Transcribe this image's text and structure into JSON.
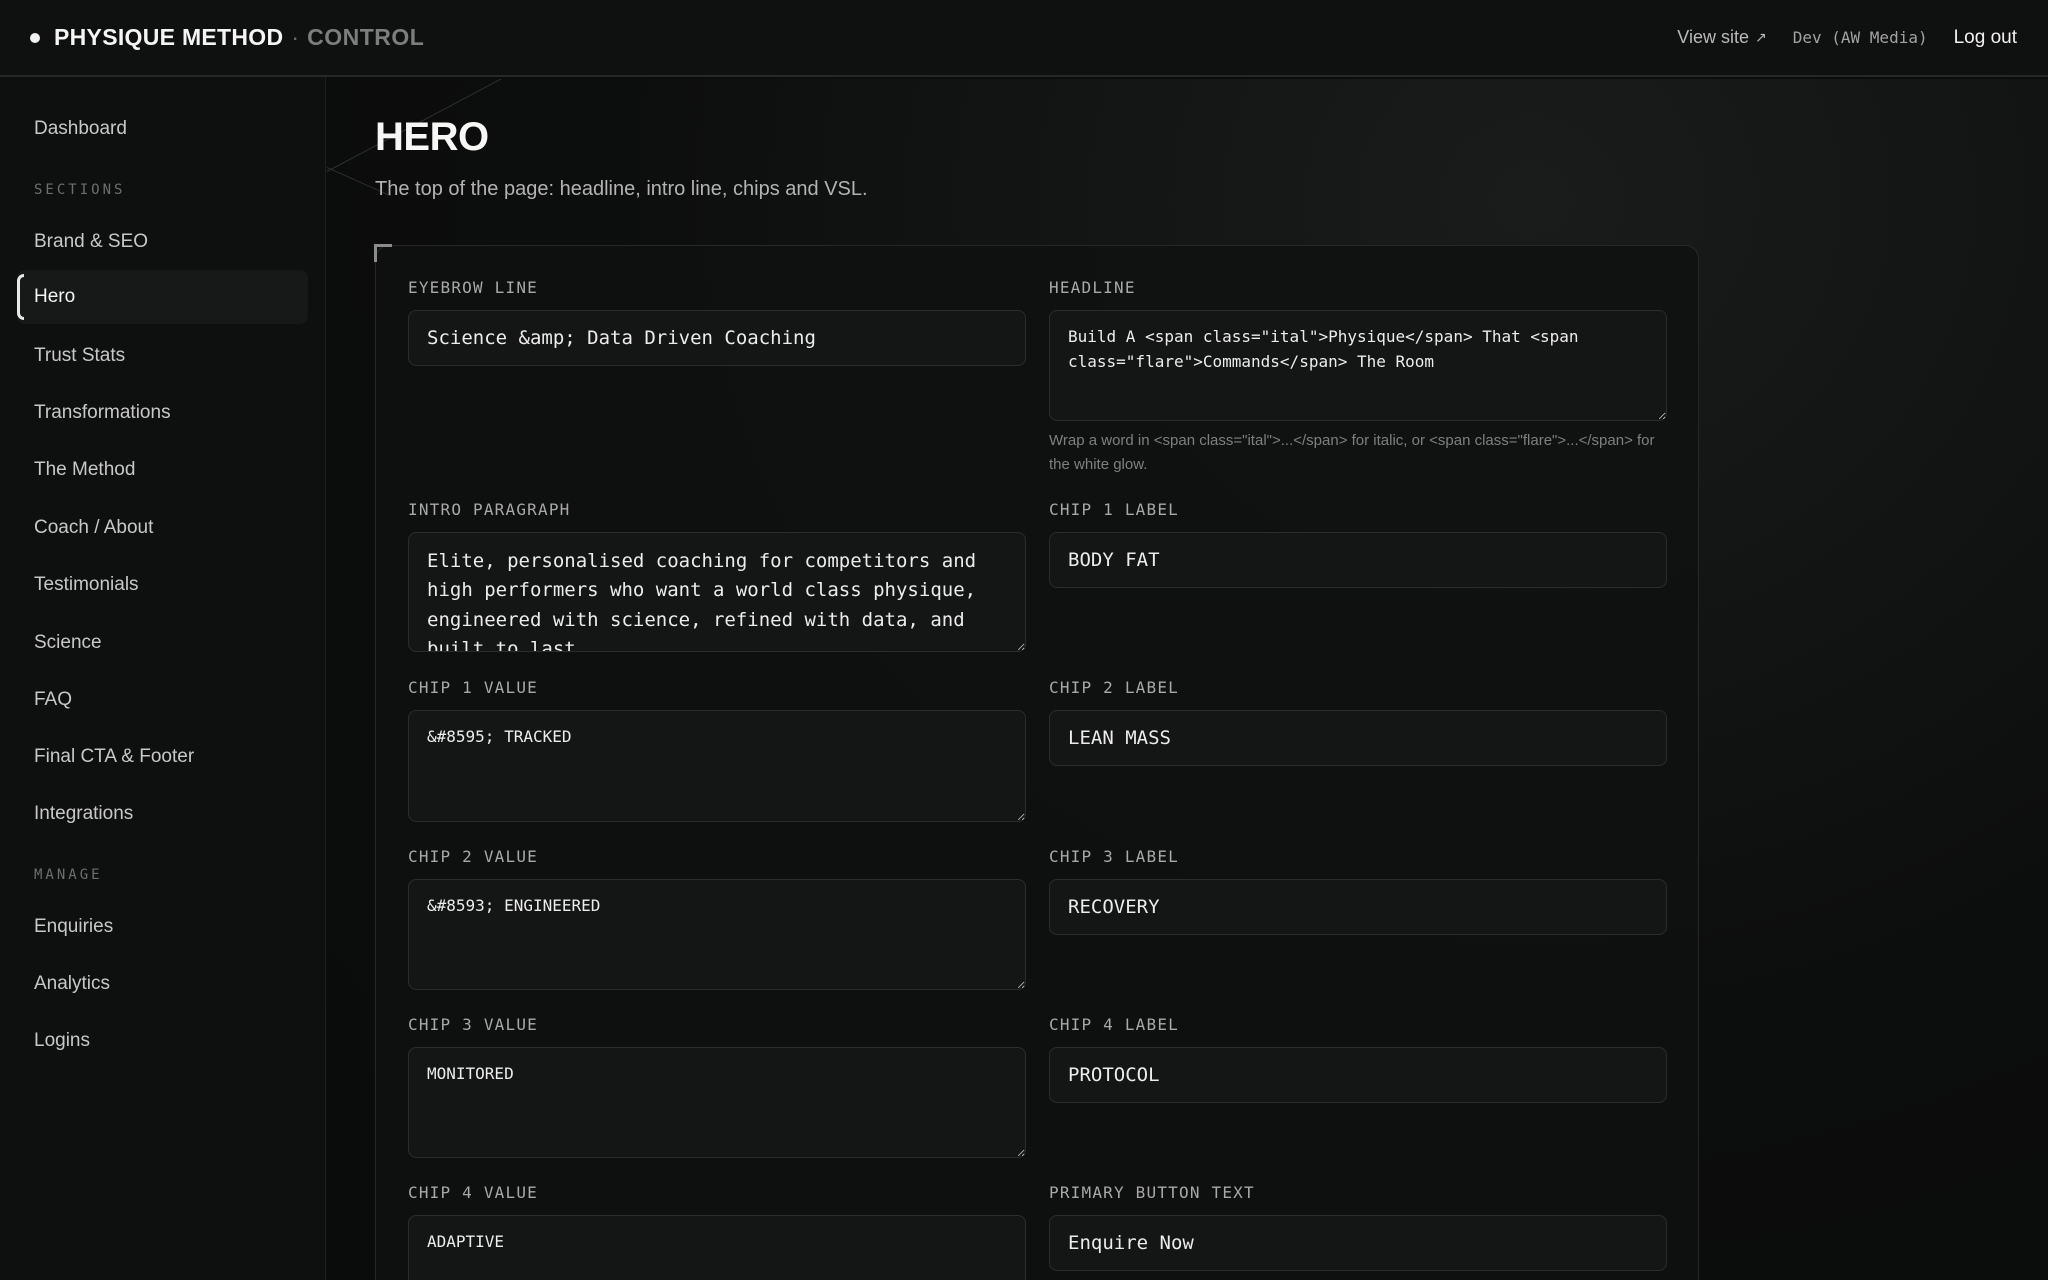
{
  "topbar": {
    "brand_name": "PHYSIQUE METHOD",
    "brand_sep": "·",
    "brand_sub": "CONTROL",
    "view_site": "View site",
    "view_site_icon": "↗",
    "env_label": "Dev (AW Media)",
    "logout": "Log out"
  },
  "sidebar": {
    "dashboard": "Dashboard",
    "sections_heading": "SECTIONS",
    "sections": [
      "Brand & SEO",
      "Hero",
      "Trust Stats",
      "Transformations",
      "The Method",
      "Coach / About",
      "Testimonials",
      "Science",
      "FAQ",
      "Final CTA & Footer",
      "Integrations"
    ],
    "active": "Hero",
    "manage_heading": "MANAGE",
    "manage": [
      "Enquiries",
      "Analytics",
      "Logins"
    ]
  },
  "page": {
    "title": "HERO",
    "subtitle": "The top of the page: headline, intro line, chips and VSL."
  },
  "form": {
    "eyebrow": {
      "label": "EYEBROW LINE",
      "value": "Science &amp; Data Driven Coaching"
    },
    "headline": {
      "label": "HEADLINE",
      "value": "Build A <span class=\"ital\">Physique</span> That <span class=\"flare\">Commands</span> The Room",
      "hint": "Wrap a word in <span class=\"ital\">...</span> for italic, or <span class=\"flare\">...</span> for the white glow."
    },
    "intro": {
      "label": "INTRO PARAGRAPH",
      "value": "Elite, personalised coaching for competitors and high performers who want a world class physique, engineered with science, refined with data, and built to last."
    },
    "chip1_label": {
      "label": "CHIP 1 LABEL",
      "value": "BODY FAT"
    },
    "chip1_value": {
      "label": "CHIP 1 VALUE",
      "value": "&#8595; TRACKED"
    },
    "chip2_label": {
      "label": "CHIP 2 LABEL",
      "value": "LEAN MASS"
    },
    "chip2_value": {
      "label": "CHIP 2 VALUE",
      "value": "&#8593; ENGINEERED"
    },
    "chip3_label": {
      "label": "CHIP 3 LABEL",
      "value": "RECOVERY"
    },
    "chip3_value": {
      "label": "CHIP 3 VALUE",
      "value": "MONITORED"
    },
    "chip4_label": {
      "label": "CHIP 4 LABEL",
      "value": "PROTOCOL"
    },
    "chip4_value": {
      "label": "CHIP 4 VALUE",
      "value": "ADAPTIVE"
    },
    "primary_button": {
      "label": "PRIMARY BUTTON TEXT",
      "value": "Enquire Now"
    }
  }
}
